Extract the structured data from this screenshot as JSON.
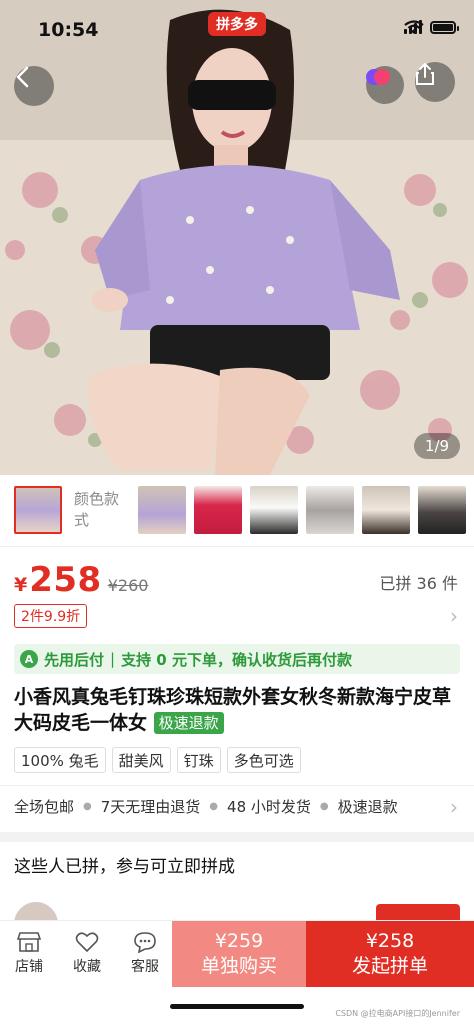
{
  "status_bar": {
    "time": "10:54"
  },
  "header": {
    "badge": "拼多多",
    "image_counter": "1/9"
  },
  "icons": {
    "back": "chevron-left-icon",
    "share": "share-icon",
    "favorite": "heart-icon",
    "store": "store-icon",
    "collect": "heart-outline-icon",
    "service": "chat-icon"
  },
  "colors": {
    "accent": "#e02e24",
    "green": "#3aa549",
    "light_red": "#f28983"
  },
  "variants": {
    "label": "颜色款式"
  },
  "price": {
    "currency": "¥",
    "current": "258",
    "original": "¥260",
    "sold": "已拼 36 件",
    "promo": "2件9.9折"
  },
  "pay_banner": {
    "badge": "A",
    "text1": "先用后付",
    "text2": "支持 0 元下单，确认收货后再付款"
  },
  "product": {
    "title": "小香风真兔毛钉珠珍珠短款外套女秋冬新款海宁皮草大码皮毛一体女",
    "fast_tag": "极速退款",
    "tags": [
      "100% 兔毛",
      "甜美风",
      "钉珠",
      "多色可选"
    ]
  },
  "service": [
    "全场包邮",
    "7天无理由退货",
    "48 小时发货",
    "极速退款"
  ],
  "group": {
    "title": "这些人已拼，参与可立即拼成"
  },
  "bottom_bar": {
    "store": "店铺",
    "collect": "收藏",
    "service": "客服",
    "single_price": "¥259",
    "single_label": "单独购买",
    "group_price": "¥258",
    "group_label": "发起拼单"
  },
  "watermark": "CSDN @拉电商API接口的Jennifer"
}
